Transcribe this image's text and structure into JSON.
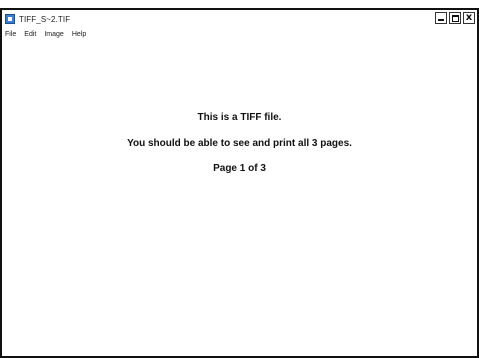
{
  "window": {
    "title": "TIFF_S~2.TIF",
    "controls": {
      "minimize": "_",
      "maximize": "□",
      "close": "x"
    }
  },
  "menubar": {
    "items": [
      "File",
      "Edit",
      "Image",
      "Help"
    ]
  },
  "document": {
    "lines": [
      "This is a TIFF file.",
      "You should be able to see and print all 3 pages.",
      "Page 1 of 3"
    ]
  },
  "colors": {
    "app_icon": "#3a7fc8",
    "border": "#111111"
  }
}
